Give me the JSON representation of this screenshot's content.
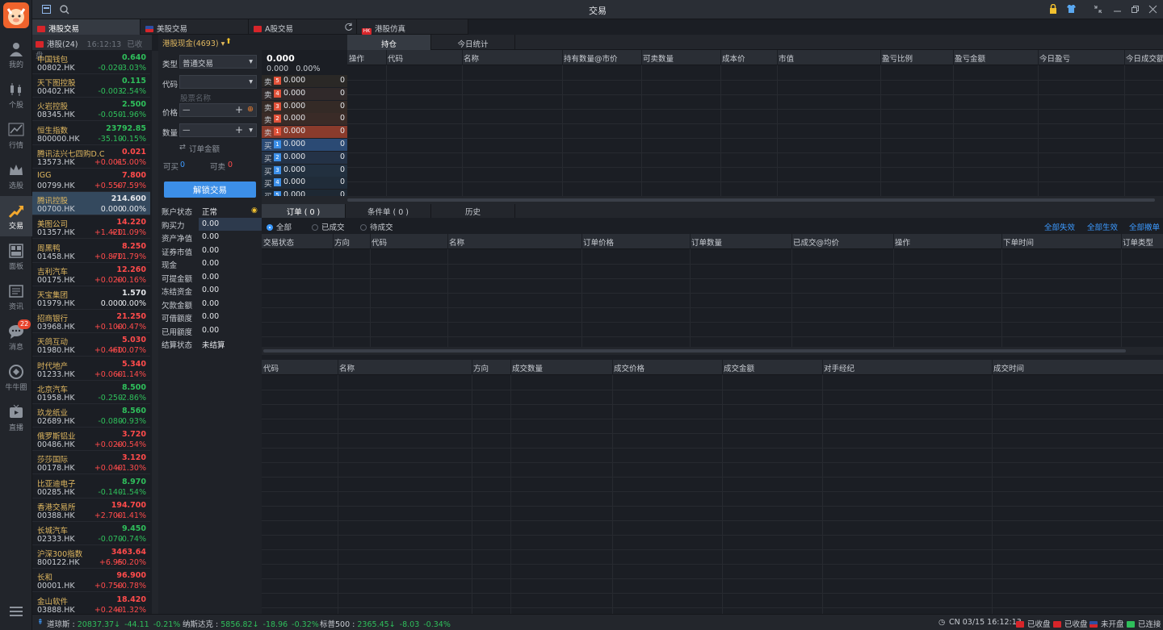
{
  "window": {
    "title": "交易"
  },
  "sidebar": [
    {
      "label": "我的",
      "icon": "user-icon"
    },
    {
      "label": "个股",
      "icon": "candlestick-icon"
    },
    {
      "label": "行情",
      "icon": "chart-line-icon"
    },
    {
      "label": "选股",
      "icon": "crown-icon"
    },
    {
      "label": "交易",
      "icon": "trade-icon"
    },
    {
      "label": "面板",
      "icon": "panel-icon"
    },
    {
      "label": "资讯",
      "icon": "news-icon"
    },
    {
      "label": "消息",
      "icon": "message-icon",
      "badge": "22"
    },
    {
      "label": "牛牛圈",
      "icon": "community-icon"
    },
    {
      "label": "直播",
      "icon": "live-icon"
    }
  ],
  "tabs": [
    {
      "label": "港股交易"
    },
    {
      "label": "美股交易"
    },
    {
      "label": "A股交易"
    },
    {
      "label": "港股仿真",
      "prefix": "HK"
    }
  ],
  "watchlist": {
    "header": {
      "name": "港股(24)",
      "time": "16:12:13",
      "status": "已收盘"
    },
    "items": [
      {
        "name": "中国钱包",
        "code": "00802.HK",
        "price": "0.640",
        "chg": "-0.020",
        "pct": "-3.03%",
        "dir": "dn"
      },
      {
        "name": "天下图控股",
        "code": "00402.HK",
        "price": "0.115",
        "chg": "-0.003",
        "pct": "-2.54%",
        "dir": "dn"
      },
      {
        "name": "火岩控股",
        "code": "08345.HK",
        "price": "2.500",
        "chg": "-0.050",
        "pct": "-1.96%",
        "dir": "dn"
      },
      {
        "name": "恒生指数",
        "code": "800000.HK",
        "price": "23792.85",
        "chg": "-35.10",
        "pct": "-0.15%",
        "dir": "dn"
      },
      {
        "name": "腾讯法兴七四购D.C",
        "code": "13573.HK",
        "price": "0.021",
        "chg": "+0.001",
        "pct": "+5.00%",
        "dir": "up"
      },
      {
        "name": "IGG",
        "code": "00799.HK",
        "price": "7.800",
        "chg": "+0.550",
        "pct": "+7.59%",
        "dir": "up"
      },
      {
        "name": "腾讯控股",
        "code": "00700.HK",
        "price": "214.600",
        "chg": "0.000",
        "pct": "0.00%",
        "dir": "ft"
      },
      {
        "name": "美图公司",
        "code": "01357.HK",
        "price": "14.220",
        "chg": "+1.420",
        "pct": "+11.09%",
        "dir": "up"
      },
      {
        "name": "周黑鸭",
        "code": "01458.HK",
        "price": "8.250",
        "chg": "+0.870",
        "pct": "+11.79%",
        "dir": "up"
      },
      {
        "name": "吉利汽车",
        "code": "00175.HK",
        "price": "12.260",
        "chg": "+0.020",
        "pct": "+0.16%",
        "dir": "up"
      },
      {
        "name": "天宝集团",
        "code": "01979.HK",
        "price": "1.570",
        "chg": "0.000",
        "pct": "0.00%",
        "dir": "ft"
      },
      {
        "name": "招商银行",
        "code": "03968.HK",
        "price": "21.250",
        "chg": "+0.100",
        "pct": "+0.47%",
        "dir": "up"
      },
      {
        "name": "天鸽互动",
        "code": "01980.HK",
        "price": "5.030",
        "chg": "+0.460",
        "pct": "+10.07%",
        "dir": "up"
      },
      {
        "name": "时代地产",
        "code": "01233.HK",
        "price": "5.340",
        "chg": "+0.060",
        "pct": "+1.14%",
        "dir": "up"
      },
      {
        "name": "北京汽车",
        "code": "01958.HK",
        "price": "8.500",
        "chg": "-0.250",
        "pct": "-2.86%",
        "dir": "dn"
      },
      {
        "name": "玖龙纸业",
        "code": "02689.HK",
        "price": "8.560",
        "chg": "-0.080",
        "pct": "-0.93%",
        "dir": "dn"
      },
      {
        "name": "俄罗斯铝业",
        "code": "00486.HK",
        "price": "3.720",
        "chg": "+0.020",
        "pct": "+0.54%",
        "dir": "up"
      },
      {
        "name": "莎莎国际",
        "code": "00178.HK",
        "price": "3.120",
        "chg": "+0.040",
        "pct": "+1.30%",
        "dir": "up"
      },
      {
        "name": "比亚迪电子",
        "code": "00285.HK",
        "price": "8.970",
        "chg": "-0.140",
        "pct": "-1.54%",
        "dir": "dn"
      },
      {
        "name": "香港交易所",
        "code": "00388.HK",
        "price": "194.700",
        "chg": "+2.700",
        "pct": "+1.41%",
        "dir": "up"
      },
      {
        "name": "长城汽车",
        "code": "02333.HK",
        "price": "9.450",
        "chg": "-0.070",
        "pct": "-0.74%",
        "dir": "dn"
      },
      {
        "name": "沪深300指数",
        "code": "800122.HK",
        "price": "3463.64",
        "chg": "+6.95",
        "pct": "+0.20%",
        "dir": "up"
      },
      {
        "name": "长和",
        "code": "00001.HK",
        "price": "96.900",
        "chg": "+0.750",
        "pct": "+0.78%",
        "dir": "up"
      },
      {
        "name": "金山软件",
        "code": "03888.HK",
        "price": "18.420",
        "chg": "+0.240",
        "pct": "+1.32%",
        "dir": "up"
      }
    ]
  },
  "order_form": {
    "account": "港股现金(4693)",
    "type_label": "类型",
    "type_value": "普通交易",
    "code_label": "代码",
    "name_placeholder": "股票名称",
    "price_label": "价格",
    "qty_label": "数量",
    "minus": "—",
    "plus": "+",
    "amount_label": "订单金额",
    "can_buy_label": "可买",
    "can_buy": "0",
    "can_sell_label": "可卖",
    "can_sell": "0",
    "unlock_button": "解锁交易"
  },
  "quote": {
    "price": "0.000",
    "chg": "0.000",
    "pct": "0.00%"
  },
  "order_book": [
    {
      "side": "卖",
      "level": "5",
      "price": "0.000",
      "qty": "0"
    },
    {
      "side": "卖",
      "level": "4",
      "price": "0.000",
      "qty": "0"
    },
    {
      "side": "卖",
      "level": "3",
      "price": "0.000",
      "qty": "0"
    },
    {
      "side": "卖",
      "level": "2",
      "price": "0.000",
      "qty": "0"
    },
    {
      "side": "卖",
      "level": "1",
      "price": "0.000",
      "qty": "0"
    },
    {
      "side": "买",
      "level": "1",
      "price": "0.000",
      "qty": "0"
    },
    {
      "side": "买",
      "level": "2",
      "price": "0.000",
      "qty": "0"
    },
    {
      "side": "买",
      "level": "3",
      "price": "0.000",
      "qty": "0"
    },
    {
      "side": "买",
      "level": "4",
      "price": "0.000",
      "qty": "0"
    },
    {
      "side": "买",
      "level": "5",
      "price": "0.000",
      "qty": "0"
    }
  ],
  "account": [
    {
      "k": "账户状态",
      "v": "正常"
    },
    {
      "k": "购买力",
      "v": "0.00"
    },
    {
      "k": "资产净值",
      "v": "0.00"
    },
    {
      "k": "证券市值",
      "v": "0.00"
    },
    {
      "k": "现金",
      "v": "0.00"
    },
    {
      "k": "可提金额",
      "v": "0.00"
    },
    {
      "k": "冻结资金",
      "v": "0.00"
    },
    {
      "k": "欠款金额",
      "v": "0.00"
    },
    {
      "k": "可借额度",
      "v": "0.00"
    },
    {
      "k": "已用额度",
      "v": "0.00"
    },
    {
      "k": "结算状态",
      "v": "未结算"
    }
  ],
  "positions": {
    "tabs": [
      "持仓",
      "今日统计"
    ],
    "columns": [
      "操作",
      "代码",
      "名称",
      "持有数量@市价",
      "可卖数量",
      "成本价",
      "市值",
      "盈亏比例",
      "盈亏金额",
      "今日盈亏",
      "今日成交额"
    ]
  },
  "orders": {
    "tabs": [
      "订单 ( 0 )",
      "条件单 ( 0 )",
      "历史"
    ],
    "filters": [
      "全部",
      "已成交",
      "待成交"
    ],
    "actions": [
      "全部失效",
      "全部生效",
      "全部撤单"
    ],
    "columns": [
      "交易状态",
      "方向",
      "代码",
      "名称",
      "订单价格",
      "订单数量",
      "已成交@均价",
      "操作",
      "下单时间",
      "订单类型"
    ]
  },
  "deals": {
    "columns": [
      "代码",
      "名称",
      "方向",
      "成交数量",
      "成交价格",
      "成交金额",
      "对手经纪",
      "成交时间"
    ]
  },
  "statusbar": {
    "idx": [
      {
        "name": "道琼斯",
        "val": "20837.37",
        "arrow": "↓",
        "chg": "-44.11",
        "pct": "-0.21%"
      },
      {
        "name": "纳斯达克",
        "val": "5856.82",
        "arrow": "↓",
        "chg": "-18.96",
        "pct": "-0.32%"
      },
      {
        "name": "标普500",
        "val": "2365.45",
        "arrow": "↓",
        "chg": "-8.03",
        "pct": "-0.34%"
      }
    ],
    "clock": "CN 03/15 16:12:13",
    "markets": [
      "已收盘",
      "已收盘",
      "未开盘",
      "已连接"
    ]
  },
  "colors": {
    "up": "#ff4b4b",
    "down": "#2fbf5b",
    "accent": "#3c8fe8",
    "stock_name": "#e0b860"
  }
}
